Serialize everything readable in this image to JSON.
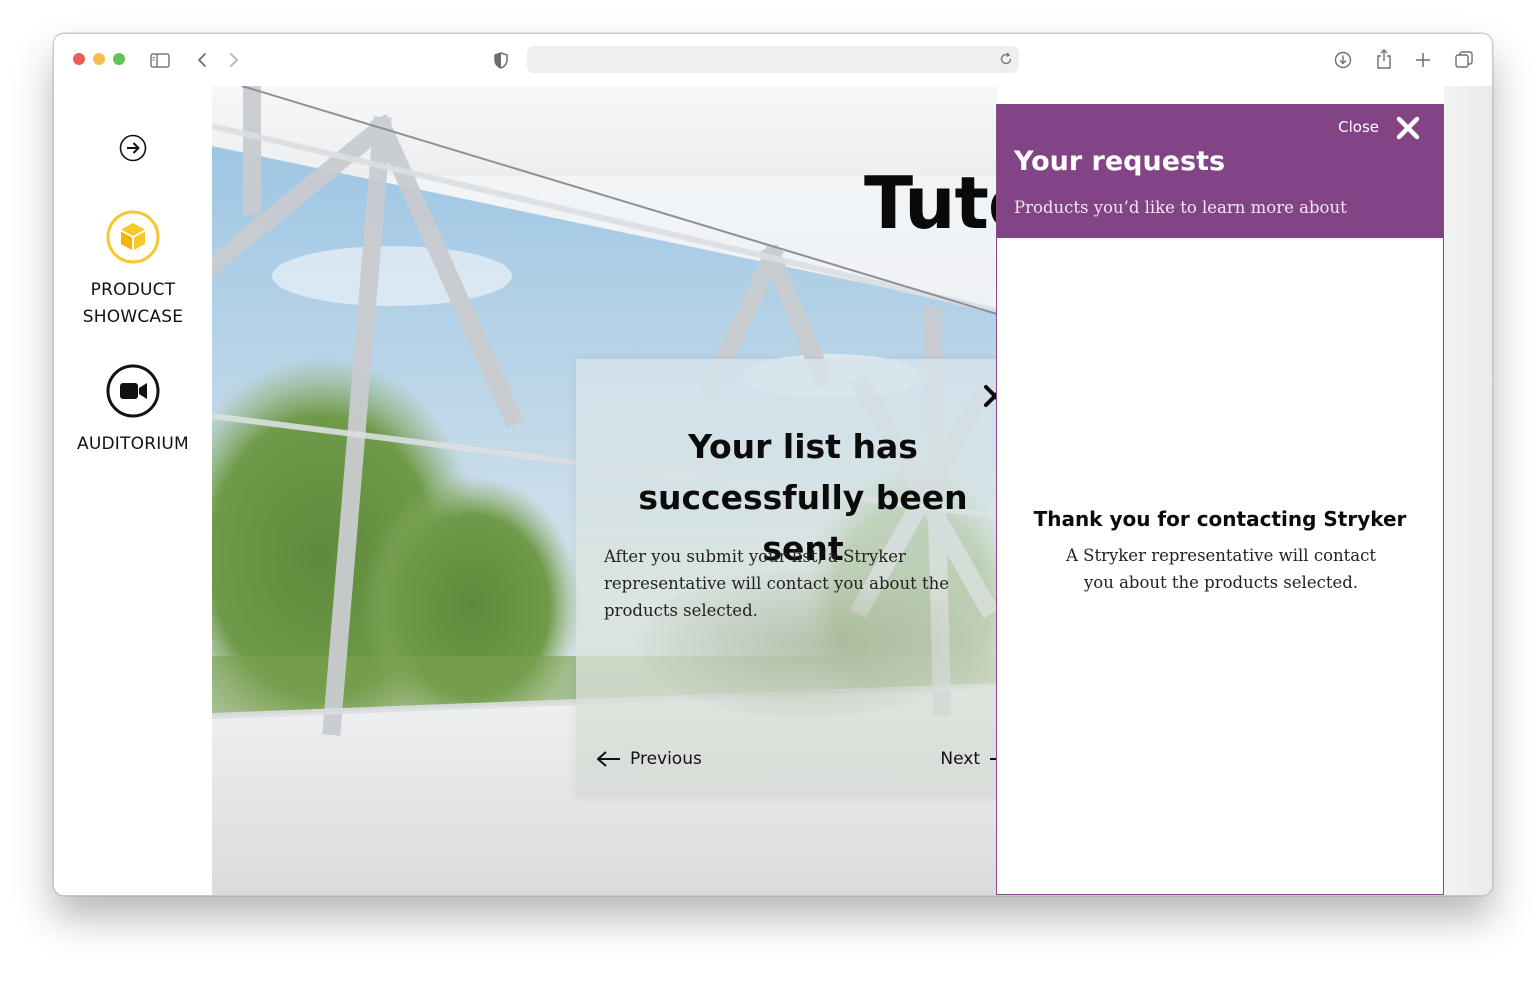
{
  "browser": {
    "url": "",
    "icons": [
      "sidebar-toggle-icon",
      "back-icon",
      "forward-icon",
      "privacy-shield-icon",
      "reload-icon",
      "download-icon",
      "share-icon",
      "new-tab-icon",
      "tab-overview-icon"
    ]
  },
  "sidebar": {
    "items": [
      {
        "label": "PRODUCT SHOWCASE",
        "icon": "cube-icon",
        "accent": "#f7c72b"
      },
      {
        "label": "AUDITORIUM",
        "icon": "video-camera-icon"
      }
    ]
  },
  "scene": {
    "title": "Tutorial"
  },
  "modal": {
    "title": "Your list has successfully been sent",
    "body": "After you submit your list, a Stryker representative will contact you about the products selected.",
    "previous_label": "Previous",
    "next_label": "Next"
  },
  "panel": {
    "close_label": "Close",
    "title": "Your requests",
    "subtitle": "Products you’d like to learn more about",
    "thank_title": "Thank you for contacting Stryker",
    "thank_body": "A Stryker representative will contact you about the products selected.",
    "header_color": "#834486"
  }
}
